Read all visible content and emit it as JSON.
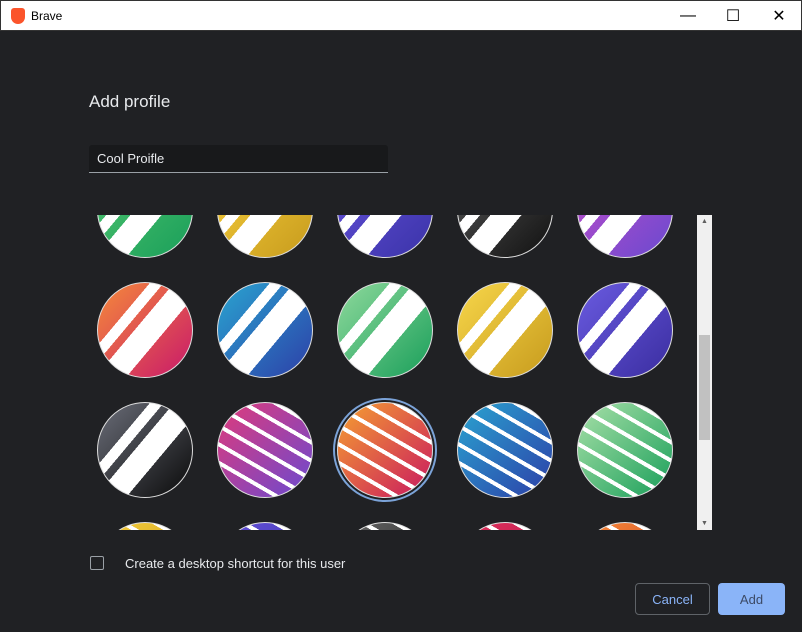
{
  "window": {
    "title": "Brave",
    "minimize_icon": "minimize-icon",
    "maximize_icon": "maximize-icon",
    "close_icon": "close-icon"
  },
  "dialog": {
    "heading": "Add profile",
    "name_value": "Cool Proifle"
  },
  "avatars": [
    {
      "name": "green-chevron",
      "c1": "#4fc36e",
      "c2": "#1a9f5a",
      "pattern": "wide"
    },
    {
      "name": "yellow-chevron",
      "c1": "#f5cd3b",
      "c2": "#c79b1d",
      "pattern": "wide"
    },
    {
      "name": "purple-chevron",
      "c1": "#6450d8",
      "c2": "#3a33a8",
      "pattern": "wide"
    },
    {
      "name": "black-chevron",
      "c1": "#555",
      "c2": "#111",
      "pattern": "wide"
    },
    {
      "name": "purple-stripes",
      "c1": "#c04cc8",
      "c2": "#6a4ad0",
      "pattern": "wide"
    },
    {
      "name": "orange-red-bars",
      "c1": "#f58a3a",
      "c2": "#c9186a",
      "pattern": "wide"
    },
    {
      "name": "blue-bars",
      "c1": "#2aa4d0",
      "c2": "#2c3fa8",
      "pattern": "wide"
    },
    {
      "name": "green-bars",
      "c1": "#8ed99c",
      "c2": "#1a9f5a",
      "pattern": "wide"
    },
    {
      "name": "yellow-bars",
      "c1": "#f7d64a",
      "c2": "#c79b1d",
      "pattern": "wide"
    },
    {
      "name": "purple-bars",
      "c1": "#6a5be0",
      "c2": "#3a2da0",
      "pattern": "wide"
    },
    {
      "name": "black-bars",
      "c1": "#6a6d78",
      "c2": "#0a0a0a",
      "pattern": "wide"
    },
    {
      "name": "pink-purple-stripes",
      "c1": "#e03a7a",
      "c2": "#6a4ad0",
      "pattern": "thin"
    },
    {
      "name": "orange-red-stripes",
      "c1": "#f5a030",
      "c2": "#c91860",
      "pattern": "thin",
      "selected": true
    },
    {
      "name": "blue-stripes",
      "c1": "#2aa4d0",
      "c2": "#2c3fa8",
      "pattern": "thin"
    },
    {
      "name": "green-stripes",
      "c1": "#a8e0a8",
      "c2": "#1a9f5a",
      "pattern": "thin"
    },
    {
      "name": "yellow-partial",
      "c1": "#f5cd3b",
      "c2": "#c79b1d",
      "pattern": "thin"
    },
    {
      "name": "purple-partial",
      "c1": "#6450d8",
      "c2": "#3a33a8",
      "pattern": "thin"
    },
    {
      "name": "black-partial",
      "c1": "#666",
      "c2": "#222",
      "pattern": "thin"
    },
    {
      "name": "red-partial",
      "c1": "#e0305a",
      "c2": "#b01850",
      "pattern": "thin"
    },
    {
      "name": "orange-partial",
      "c1": "#f58a3a",
      "c2": "#d04020",
      "pattern": "thin"
    }
  ],
  "shortcut": {
    "label": "Create a desktop shortcut for this user",
    "checked": false
  },
  "buttons": {
    "cancel": "Cancel",
    "add": "Add"
  },
  "colors": {
    "accent": "#8ab4f8",
    "background": "#202124"
  }
}
